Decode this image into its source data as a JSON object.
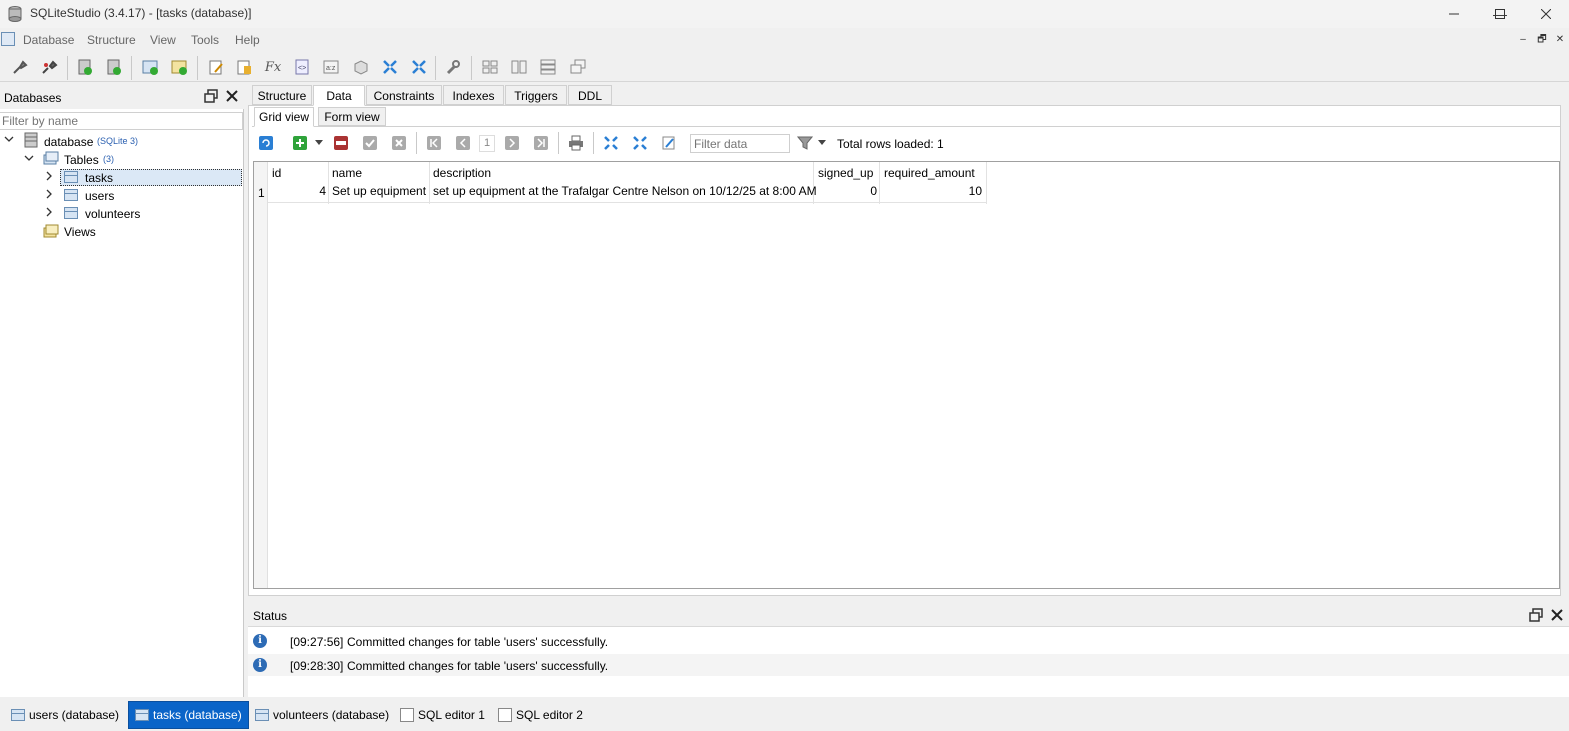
{
  "window": {
    "title": "SQLiteStudio (3.4.17) - [tasks (database)]",
    "minimize_icon": "minimize-icon",
    "maximize_icon": "maximize-icon",
    "close_icon": "close-icon"
  },
  "menubar": {
    "items": [
      "Database",
      "Structure",
      "View",
      "Tools",
      "Help"
    ],
    "mdi_controls": [
      "–",
      "🗗",
      "✕"
    ]
  },
  "toolbar": {
    "icons": [
      "connect-db-icon",
      "disconnect-db-icon",
      "add-db-icon",
      "remove-db-icon",
      "create-table-icon",
      "create-view-icon",
      "sql-editor-icon",
      "edit-icon",
      "functions-icon",
      "ddl-history-icon",
      "collations-icon",
      "extensions-icon",
      "import-icon",
      "export-icon",
      "config-icon",
      "tile-icon",
      "tile-horizontal-icon",
      "tile-vertical-icon",
      "cascade-icon"
    ]
  },
  "databases_panel": {
    "title": "Databases",
    "filter_placeholder": "Filter by name",
    "db_name": "database",
    "db_type": "(SQLite 3)",
    "tables_label": "Tables",
    "tables_count": "(3)",
    "tables": [
      "tasks",
      "users",
      "volunteers"
    ],
    "views_label": "Views"
  },
  "editor": {
    "tabs": [
      "Structure",
      "Data",
      "Constraints",
      "Indexes",
      "Triggers",
      "DDL"
    ],
    "active_tab": "Data",
    "subtabs": [
      "Grid view",
      "Form view"
    ],
    "filter_placeholder": "Filter data",
    "page_number": "1",
    "total_rows": "Total rows loaded: 1"
  },
  "grid": {
    "columns": [
      "id",
      "name",
      "description",
      "signed_up",
      "required_amount"
    ],
    "rows": [
      {
        "row_number": "1",
        "id": "4",
        "name": "Set up equipment",
        "description": "set up equipment at the Trafalgar Centre Nelson on 10/12/25 at 8:00 AM",
        "signed_up": "0",
        "required_amount": "10"
      }
    ]
  },
  "status": {
    "title": "Status",
    "messages": [
      {
        "time": "[09:27:56]",
        "text": "Committed changes for table 'users' successfully."
      },
      {
        "time": "[09:28:30]",
        "text": "Committed changes for table 'users' successfully."
      }
    ]
  },
  "taskbar": {
    "items": [
      "users (database)",
      "tasks (database)",
      "volunteers (database)",
      "SQL editor 1",
      "SQL editor 2"
    ],
    "active": "tasks (database)"
  },
  "colors": {
    "accent": "#0a64c8",
    "info": "#2d6bb5"
  }
}
